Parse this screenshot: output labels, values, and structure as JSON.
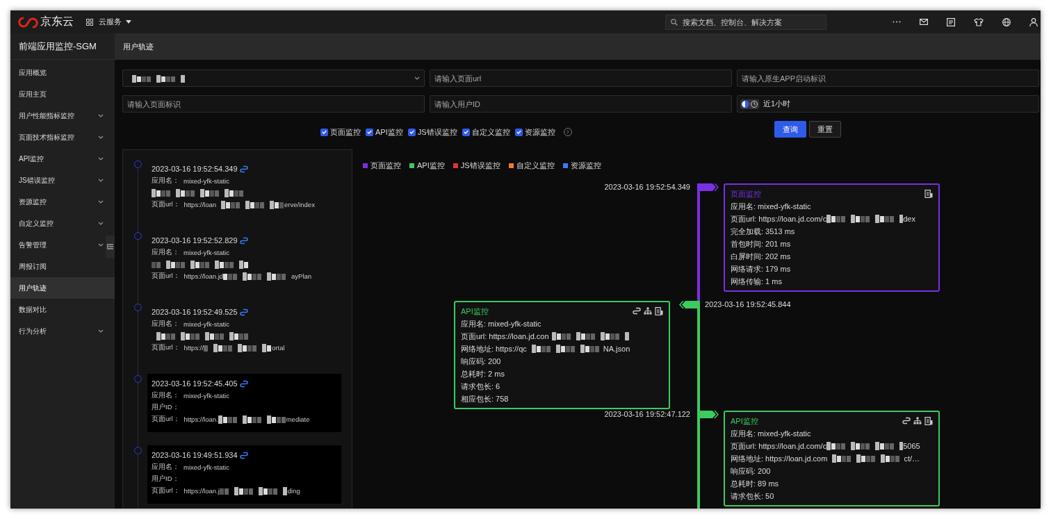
{
  "topbar": {
    "logo": "京东云",
    "menu": "云服务",
    "search": {
      "placeholder": "搜索文档、控制台、解决方案"
    }
  },
  "sidebar": {
    "title": "前端应用监控-SGM",
    "items": [
      {
        "label": "应用概览",
        "expandable": false,
        "selected": false
      },
      {
        "label": "应用主页",
        "expandable": false,
        "selected": false
      },
      {
        "label": "用户性能指标监控",
        "expandable": true,
        "selected": false
      },
      {
        "label": "页面技术指标监控",
        "expandable": true,
        "selected": false
      },
      {
        "label": "API监控",
        "expandable": true,
        "selected": false
      },
      {
        "label": "JS错误监控",
        "expandable": true,
        "selected": false
      },
      {
        "label": "资源监控",
        "expandable": true,
        "selected": false
      },
      {
        "label": "自定义监控",
        "expandable": true,
        "selected": false
      },
      {
        "label": "告警管理",
        "expandable": true,
        "selected": false
      },
      {
        "label": "周报订阅",
        "expandable": false,
        "selected": false
      },
      {
        "label": "用户轨迹",
        "expandable": false,
        "selected": true
      },
      {
        "label": "数据对比",
        "expandable": false,
        "selected": false
      },
      {
        "label": "行为分析",
        "expandable": true,
        "selected": false
      }
    ]
  },
  "page": {
    "title": "用户轨迹"
  },
  "filters": [
    {
      "kind": "select",
      "masked": true
    },
    {
      "kind": "input",
      "placeholder": "请输入页面url"
    },
    {
      "kind": "input",
      "placeholder": "请输入原生APP启动标识"
    },
    {
      "kind": "input",
      "placeholder": "请输入页面标识"
    },
    {
      "kind": "input",
      "placeholder": "请输入用户ID"
    },
    {
      "kind": "time",
      "value": "近1小时"
    }
  ],
  "types": [
    {
      "label": "页面监控",
      "checked": true
    },
    {
      "label": "API监控",
      "checked": true
    },
    {
      "label": "JS错误监控",
      "checked": true
    },
    {
      "label": "自定义监控",
      "checked": true
    },
    {
      "label": "资源监控",
      "checked": true
    }
  ],
  "help": "?",
  "buttons": [
    {
      "label": "查询",
      "kind": "primary"
    },
    {
      "label": "重置",
      "kind": "default"
    }
  ],
  "sessions": [
    {
      "time": "2023-03-16 19:52:54.349",
      "highlighted": false,
      "lines": [
        {
          "label": "应用名：",
          "value": "mixed-yfk-static",
          "masked": false
        },
        {
          "masked": true
        },
        {
          "label": "页面url：",
          "value": "https://loan",
          "masked": true,
          "tail": "erve/index"
        }
      ]
    },
    {
      "time": "2023-03-16 19:52:52.829",
      "highlighted": false,
      "lines": [
        {
          "label": "应用名：",
          "value": "mixed-yfk-static",
          "masked": false
        },
        {
          "masked": true
        },
        {
          "label": "页面url：",
          "value": "https://loan.jd",
          "masked": true,
          "tail": "ayPlan"
        }
      ]
    },
    {
      "time": "2023-03-16 19:52:49.525",
      "highlighted": false,
      "lines": [
        {
          "label": "应用名：",
          "value": "mixed-yfk-static",
          "masked": false
        },
        {
          "masked": true
        },
        {
          "label": "页面url：",
          "value": "https://",
          "masked": true,
          "tail": "ortal"
        }
      ]
    },
    {
      "time": "2023-03-16 19:52:45.405",
      "highlighted": true,
      "lines": [
        {
          "label": "应用名：",
          "value": "mixed-yfk-static",
          "masked": false
        },
        {
          "label": "用户ID：",
          "masked": false
        },
        {
          "label": "页面url：",
          "value": "https://loan.",
          "masked": true,
          "tail": "mediate"
        }
      ]
    },
    {
      "time": "2023-03-16 19:49:51.934",
      "highlighted": true,
      "lines": [
        {
          "label": "应用名：",
          "value": "mixed-yfk-static",
          "masked": false
        },
        {
          "label": "用户ID：",
          "masked": false
        },
        {
          "label": "页面url：",
          "value": "https://loan.j",
          "masked": true,
          "tail": "ding"
        }
      ]
    }
  ],
  "legend": [
    {
      "label": "页面监控",
      "color": "#7b2fe3"
    },
    {
      "label": "API监控",
      "color": "#3ccb5f"
    },
    {
      "label": "JS错误监控",
      "color": "#d9363e"
    },
    {
      "label": "自定义监控",
      "color": "#f07b2f"
    },
    {
      "label": "资源监控",
      "color": "#3b7cf5"
    }
  ],
  "events": [
    {
      "time": "2023-03-16 19:52:54.349",
      "kind": "page",
      "card_left": false,
      "color": "#7b2fe3",
      "title": "页面监控",
      "lines": [
        {
          "text": "应用名: mixed-yfk-static",
          "masked": false
        },
        {
          "text": "页面url: https://loan.jd.com/c",
          "masked": true,
          "tail": "dex"
        },
        {
          "text": "完全加载: 3513 ms",
          "masked": false
        },
        {
          "text": "首包时间: 201 ms",
          "masked": false
        },
        {
          "text": "白屏时间: 202 ms",
          "masked": false
        },
        {
          "text": "网络请求: 179 ms",
          "masked": false
        },
        {
          "text": "网络传输: 1 ms",
          "masked": false
        }
      ]
    },
    {
      "time": "2023-03-16 19:52:45.844",
      "kind": "api",
      "card_left": true,
      "color": "#3ccb5f",
      "title": "API监控",
      "lines": [
        {
          "text": "应用名: mixed-yfk-static",
          "masked": false
        },
        {
          "text": "页面url: https://loan.jd.con",
          "masked": true
        },
        {
          "text": "网络地址: https://qc",
          "masked": true,
          "tail": "NA.json"
        },
        {
          "text": "响应码: 200",
          "masked": false
        },
        {
          "text": "总耗时: 2 ms",
          "masked": false
        },
        {
          "text": "请求包长: 6",
          "masked": false
        },
        {
          "text": "相应包长: 758",
          "masked": false
        }
      ]
    },
    {
      "time": "2023-03-16 19:52:47.122",
      "kind": "api",
      "card_left": false,
      "color": "#3ccb5f",
      "title": "API监控",
      "lines": [
        {
          "text": "应用名: mixed-yfk-static",
          "masked": false
        },
        {
          "text": "页面url: https://loan.jd.com/c",
          "masked": true,
          "tail": "5065"
        },
        {
          "text": "网络地址: https://loan.jd.com",
          "masked": true,
          "tail": "ct/…"
        },
        {
          "text": "响应码: 200",
          "masked": false
        },
        {
          "text": "总耗时: 89 ms",
          "masked": false
        },
        {
          "text": "请求包长: 50",
          "masked": false
        }
      ]
    }
  ]
}
